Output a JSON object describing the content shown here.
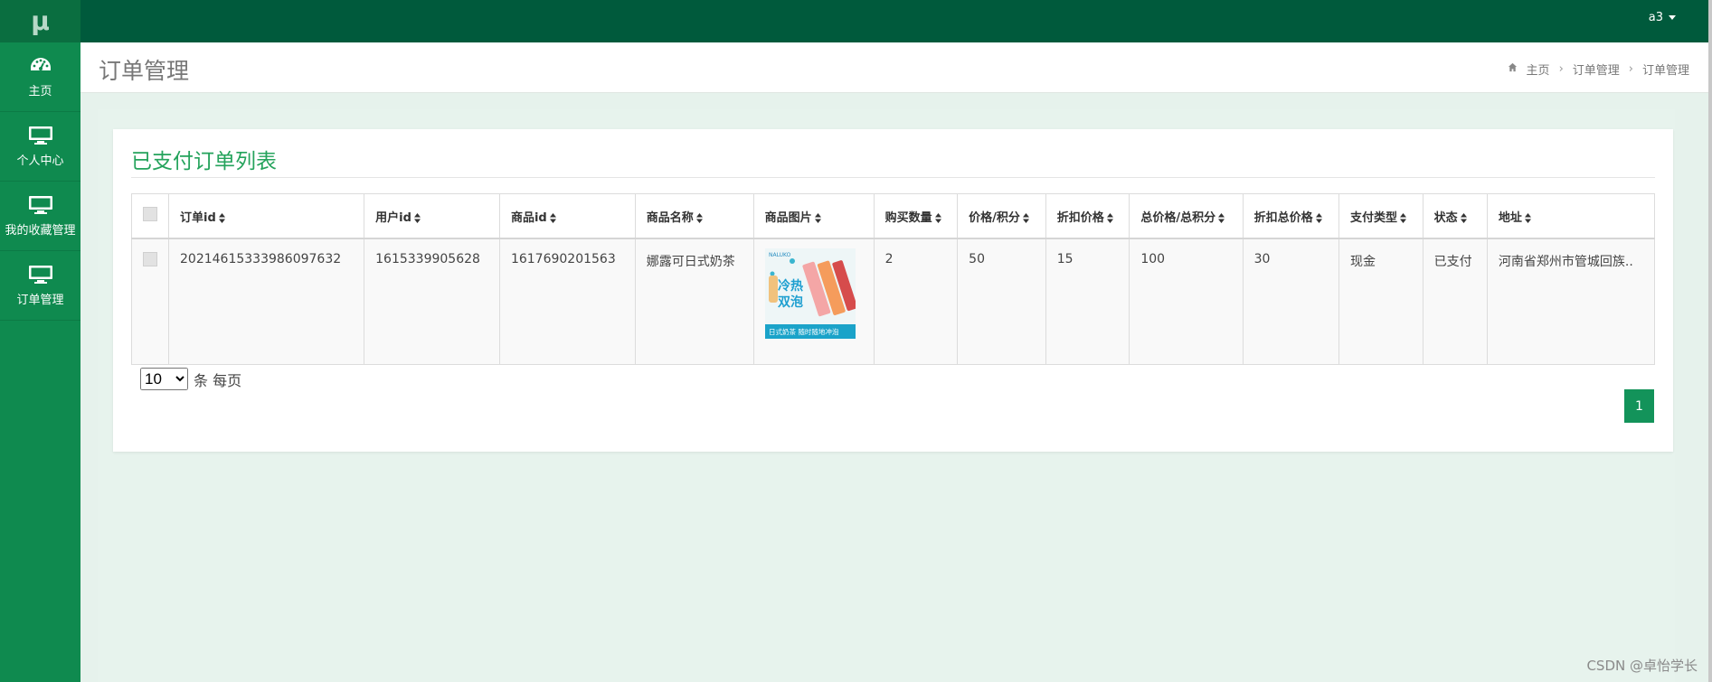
{
  "app": {
    "logo": "μ"
  },
  "sidebar": {
    "items": [
      {
        "label": "主页",
        "icon": "dashboard-icon"
      },
      {
        "label": "个人中心",
        "icon": "monitor-icon"
      },
      {
        "label": "我的收藏管理",
        "icon": "monitor-icon"
      },
      {
        "label": "订单管理",
        "icon": "monitor-icon"
      }
    ]
  },
  "topbar": {
    "user": "a3"
  },
  "header": {
    "title": "订单管理",
    "breadcrumb": [
      "主页",
      "订单管理",
      "订单管理"
    ]
  },
  "panel": {
    "title": "已支付订单列表"
  },
  "table": {
    "columns": [
      "订单id",
      "用户id",
      "商品id",
      "商品名称",
      "商品图片",
      "购买数量",
      "价格/积分",
      "折扣价格",
      "总价格/总积分",
      "折扣总价格",
      "支付类型",
      "状态",
      "地址"
    ],
    "rows": [
      {
        "order_id": "20214615333986097632",
        "user_id": "1615339905628",
        "product_id": "1617690201563",
        "product_name": "娜露可日式奶茶",
        "image_caption": "日式奶茶 随时随地冲泡",
        "image_headline": "冷热双泡",
        "quantity": "2",
        "price": "50",
        "discount_price": "15",
        "total": "100",
        "discount_total": "30",
        "pay_type": "现金",
        "status": "已支付",
        "address": "河南省郑州市管城回族.."
      }
    ]
  },
  "pager": {
    "page_size": "10",
    "page_size_options": [
      "10"
    ],
    "suffix": "条 每页",
    "current_page": "1"
  },
  "watermark": "CSDN @卓怡学长",
  "colors": {
    "sidebar": "#0f8a4f",
    "topbar": "#005a3c",
    "accent": "#25a35c",
    "page_button": "#13935a"
  }
}
